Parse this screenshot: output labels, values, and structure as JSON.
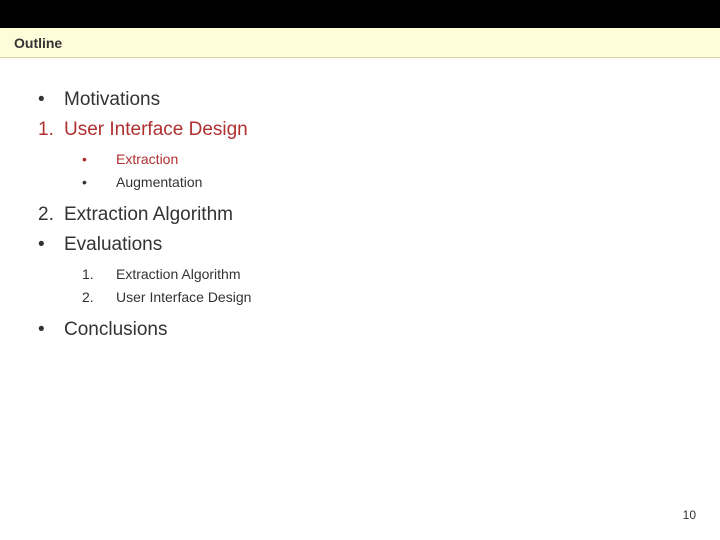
{
  "title": "Outline",
  "items": [
    {
      "marker": "•",
      "text": "Motivations",
      "highlighted": false
    },
    {
      "marker": "1.",
      "text": "User Interface Design",
      "highlighted": true,
      "sub": [
        {
          "marker": "•",
          "text": "Extraction",
          "highlighted": true
        },
        {
          "marker": "•",
          "text": "Augmentation",
          "highlighted": false
        }
      ]
    },
    {
      "marker": "2.",
      "text": "Extraction Algorithm",
      "highlighted": false
    },
    {
      "marker": "•",
      "text": "Evaluations",
      "highlighted": false,
      "sub": [
        {
          "marker": "1.",
          "text": "Extraction Algorithm",
          "highlighted": false
        },
        {
          "marker": "2.",
          "text": "User Interface Design",
          "highlighted": false
        }
      ]
    },
    {
      "marker": "•",
      "text": "Conclusions",
      "highlighted": false
    }
  ],
  "page_number": "10"
}
